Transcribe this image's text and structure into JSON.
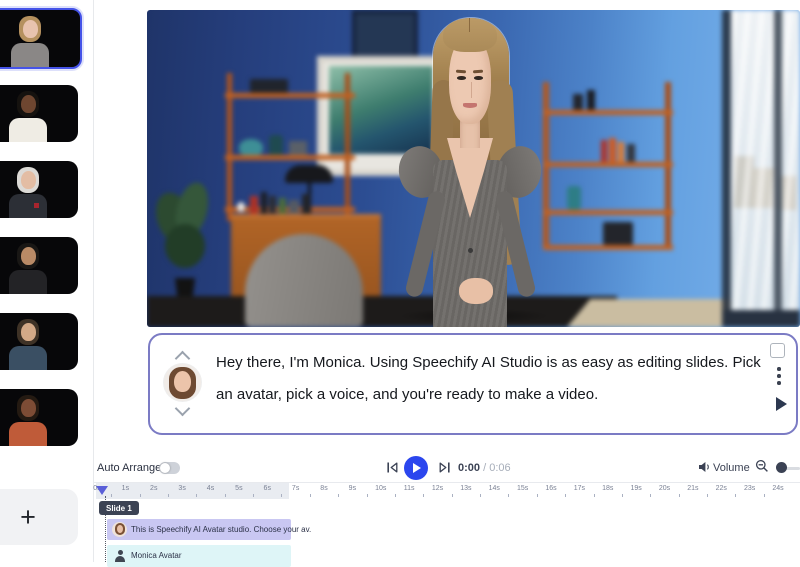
{
  "sidebar": {
    "add_button_label": "+",
    "avatars": [
      {
        "icon": "monica-avatar-thumb",
        "selected": true,
        "skin": "#e8c3ae",
        "hair": "#b5915f",
        "shirt": "#8a8786"
      },
      {
        "icon": "white-shirt-man-avatar-thumb",
        "selected": false,
        "skin": "#6e4630",
        "hair": "#15120f",
        "shirt": "#efece4"
      },
      {
        "icon": "older-man-suit-avatar-thumb",
        "selected": false,
        "skin": "#e3bda4",
        "hair": "#dcdad6",
        "shirt": "#2c2f36",
        "accent": "#a8252e"
      },
      {
        "icon": "black-tee-man-avatar-thumb",
        "selected": false,
        "skin": "#b98a66",
        "hair": "#191715",
        "shirt": "#232326"
      },
      {
        "icon": "navy-polo-man-avatar-thumb",
        "selected": false,
        "skin": "#d3a987",
        "hair": "#3e3226",
        "shirt": "#3a4f63"
      },
      {
        "icon": "rust-dress-woman-avatar-thumb",
        "selected": false,
        "skin": "#7d4c35",
        "hair": "#241a12",
        "shirt": "#bf5b39"
      }
    ]
  },
  "script_panel": {
    "text": "Hey there, I'm Monica. Using Speechify AI Studio is as easy as editing slides. Pick an avatar, pick a voice, and you're ready to make a video."
  },
  "controls": {
    "auto_arrange_label": "Auto Arrange",
    "auto_arrange_on": false,
    "current_time": "0:00",
    "time_separator": "/",
    "duration": "0:06",
    "volume_label": "Volume"
  },
  "timeline": {
    "slide_badge": "Slide 1",
    "script_clip_text": "This is Speechify AI Avatar studio. Choose your av.",
    "avatar_clip_text": "Monica Avatar",
    "ruler_ticks": [
      "0s",
      "1s",
      "2s",
      "3s",
      "4s",
      "5s",
      "6s",
      "7s",
      "8s",
      "9s",
      "10s",
      "11s",
      "12s",
      "13s",
      "14s",
      "15s",
      "16s",
      "17s",
      "18s",
      "19s",
      "20s",
      "21s",
      "22s",
      "23s",
      "24s"
    ]
  },
  "colors": {
    "accent_blue": "#2b46ee",
    "selected_thumb_border": "#4553e8",
    "script_panel_border": "#7b7bc4",
    "slide_badge_bg": "#3c4354",
    "script_clip_bg": "#c9c7f2",
    "avatar_clip_bg": "#def5f7",
    "playhead": "#5a5fd8"
  }
}
